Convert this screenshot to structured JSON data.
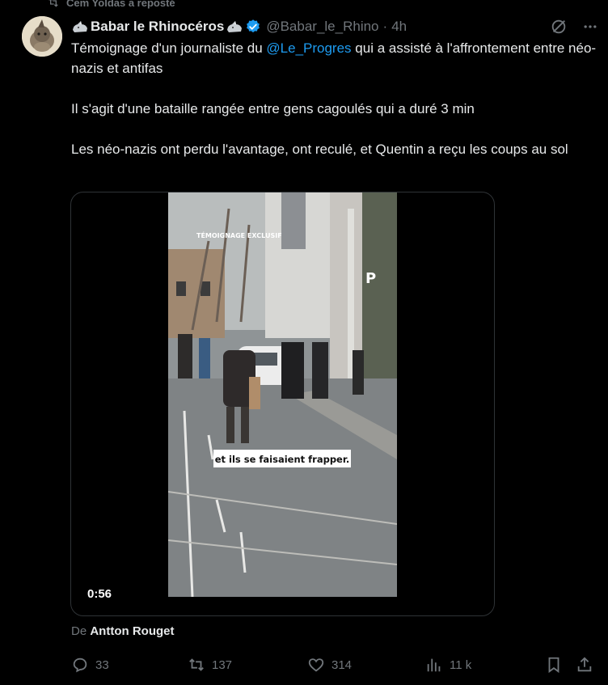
{
  "repost": {
    "label": "Cem Yoldas a reposté"
  },
  "author": {
    "name": "Babar le Rhinocéros",
    "handle": "@Babar_le_Rhino",
    "separator": "·",
    "time": "4h"
  },
  "tweet": {
    "line1_before": "Témoignage d'un journaliste du ",
    "mention": "@Le_Progres",
    "line1_after": " qui a assisté à l'affrontement entre néo-nazis et antifas",
    "para2": "Il s'agit d'une bataille rangée entre gens cagoulés qui a duré 3 min",
    "para3": "Les néo-nazis ont perdu l'avantage, ont reculé, et Quentin a reçu les coups au sol"
  },
  "video": {
    "overlay_top": "TÉMOIGNAGE EXCLUSIF",
    "caption": "et ils se faisaient frapper.",
    "duration": "0:56"
  },
  "source": {
    "prefix": "De ",
    "name": "Antton Rouget"
  },
  "actions": {
    "replies": "33",
    "reposts": "137",
    "likes": "314",
    "views": "11 k"
  },
  "colors": {
    "background": "#000000",
    "text": "#e7e9ea",
    "muted": "#71767b",
    "link": "#1d9bf0",
    "verified": "#1d9bf0",
    "border": "#2f3336"
  },
  "icons": [
    "repost-icon",
    "rhino-emoji-icon",
    "verified-badge-icon",
    "grok-icon",
    "more-icon",
    "reply-icon",
    "retweet-icon",
    "like-icon",
    "views-icon",
    "bookmark-icon",
    "share-icon"
  ]
}
